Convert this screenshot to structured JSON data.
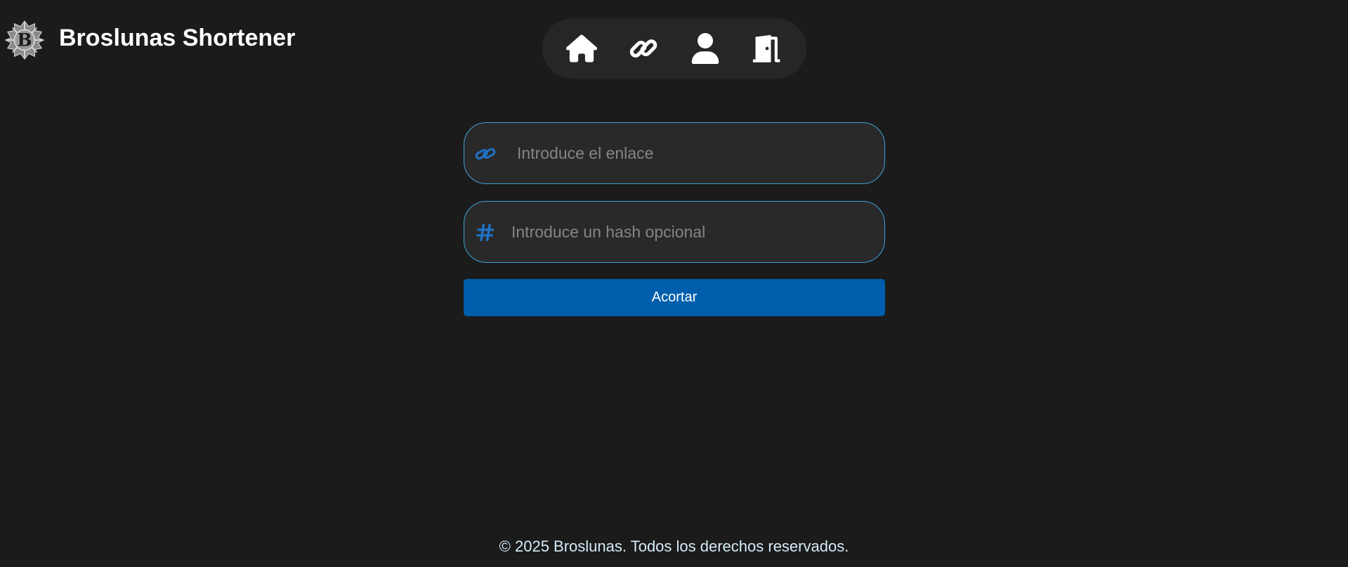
{
  "header": {
    "brand_title": "Broslunas Shortener",
    "logo_icon": "broslunas-b-logo-icon",
    "logo_letter": "B"
  },
  "nav": {
    "items": [
      {
        "icon": "home-icon",
        "label": "Inicio"
      },
      {
        "icon": "link-icon",
        "label": "Enlaces"
      },
      {
        "icon": "user-icon",
        "label": "Perfil"
      },
      {
        "icon": "door-exit-icon",
        "label": "Salir"
      }
    ]
  },
  "form": {
    "url_field": {
      "icon": "link-icon",
      "placeholder": "Introduce el enlace",
      "value": ""
    },
    "hash_field": {
      "icon": "hash-icon",
      "placeholder": "Introduce un hash opcional",
      "value": ""
    },
    "submit_label": "Acortar"
  },
  "footer": {
    "text": "© 2025 Broslunas. Todos los derechos reservados."
  },
  "colors": {
    "background": "#1b1b1b",
    "nav_background": "#262626",
    "input_background": "#292929",
    "input_border": "#3ea2db",
    "accent_icon": "#1f73c7",
    "button": "#005eac",
    "footer_text": "#d4ecf7"
  }
}
